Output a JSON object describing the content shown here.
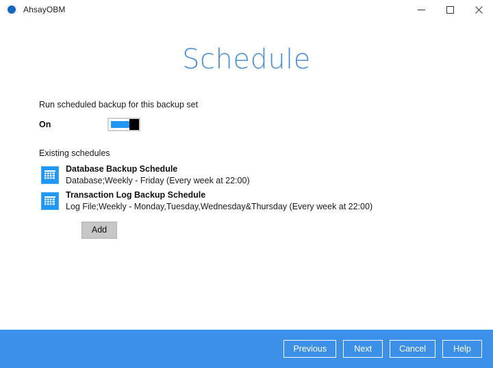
{
  "window": {
    "title": "AhsayOBM",
    "app_icon": "bullseye-icon",
    "controls": {
      "minimize": "minimize-icon",
      "maximize": "maximize-icon",
      "close": "close-icon"
    }
  },
  "page": {
    "heading": "Schedule"
  },
  "schedule_settings": {
    "run_backup_label": "Run scheduled backup for this backup set",
    "toggle_state_label": "On",
    "toggle_on": true,
    "existing_schedules_label": "Existing schedules",
    "add_button_label": "Add"
  },
  "schedules": [
    {
      "icon": "calendar-icon",
      "title": "Database Backup Schedule",
      "description": "Database;Weekly - Friday (Every week at 22:00)"
    },
    {
      "icon": "calendar-icon",
      "title": "Transaction Log Backup Schedule",
      "description": "Log File;Weekly - Monday,Tuesday,Wednesday&Thursday (Every week at 22:00)"
    }
  ],
  "footer": {
    "previous_label": "Previous",
    "next_label": "Next",
    "cancel_label": "Cancel",
    "help_label": "Help"
  },
  "colors": {
    "accent_blue": "#3d90e8",
    "heading_blue": "#4a90d9",
    "toggle_blue": "#2196f3",
    "icon_blue": "#2196f3"
  }
}
